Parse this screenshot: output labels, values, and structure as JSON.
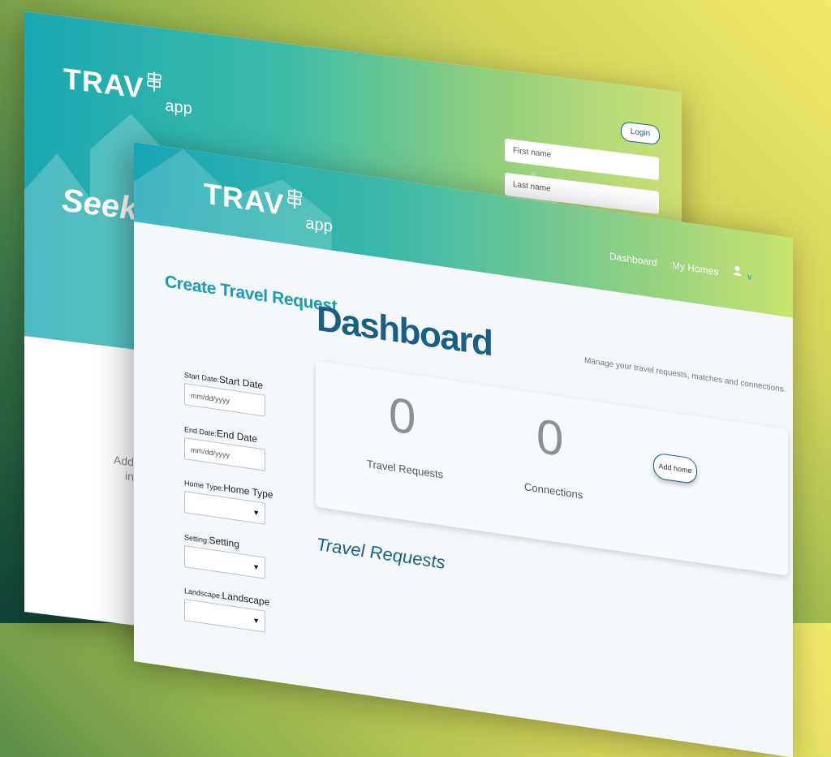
{
  "back": {
    "logo": {
      "name": "TRAV",
      "suffix": "app"
    },
    "hero_text": "Seek",
    "login_label": "Login",
    "first_name_placeholder": "First name",
    "last_name_placeholder": "Last name",
    "footer_fragment_1": "Add",
    "footer_fragment_2": "in"
  },
  "front": {
    "logo": {
      "name": "TRAV",
      "suffix": "app"
    },
    "nav": {
      "dashboard": "Dashboard",
      "my_homes": "My Homes"
    },
    "sidebar": {
      "title": "Create Travel Request",
      "start_date": {
        "prefix": "Start Date:",
        "label": "Start Date",
        "placeholder": "mm/dd/yyyy"
      },
      "end_date": {
        "prefix": "End Date:",
        "label": "End Date",
        "placeholder": "mm/dd/yyyy"
      },
      "home_type": {
        "prefix": "Home Type:",
        "label": "Home Type"
      },
      "setting": {
        "prefix": "Setting:",
        "label": "Setting"
      },
      "landscape": {
        "prefix": "Landscape:",
        "label": "Landscape"
      }
    },
    "main": {
      "title": "Dashboard",
      "subtitle": "Manage your travel requests, matches and connections.",
      "stats": [
        {
          "value": "0",
          "label": "Travel Requests"
        },
        {
          "value": "0",
          "label": "Connections"
        }
      ],
      "add_home_label": "Add home",
      "section_title": "Travel Requests"
    }
  },
  "colors": {
    "brand_dark": "#1b5e84",
    "brand_teal": "#1b9ab0",
    "gradient_start": "#17a6b5",
    "gradient_end": "#c9e46f"
  },
  "icons": {
    "logo": "signpost-icon",
    "user": "user-icon",
    "chevron": "chevron-down-icon",
    "select_arrow": "triangle-down-icon"
  }
}
